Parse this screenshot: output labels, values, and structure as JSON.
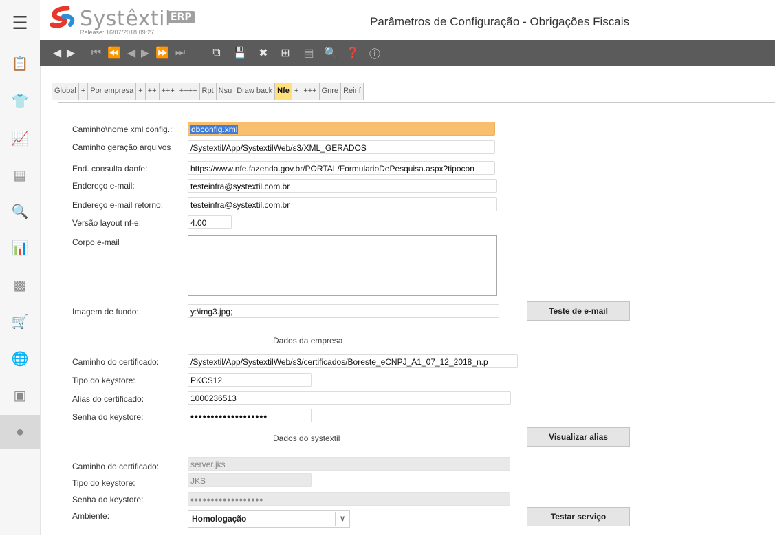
{
  "app": {
    "logo_text": "Systêxtil",
    "erp_badge": "ERP",
    "release": "Release: 16/07/2018 09:27",
    "title": "Parâmetros de Configuração - Obrigações Fiscais"
  },
  "sidebar_icons": [
    "hamburger-icon",
    "clipboard-icon",
    "shirt-icon",
    "chart-icon",
    "calculator-icon",
    "document-search-icon",
    "bar-chart-icon",
    "building-icon",
    "cart-icon",
    "globe-icon",
    "monitor-icon",
    "circle-nav-icon"
  ],
  "toolbar_icons": [
    "play-back",
    "play-forward",
    "first",
    "previous-page",
    "previous",
    "next",
    "next-page",
    "last",
    "new",
    "save",
    "delete",
    "export",
    "records",
    "zoom",
    "help",
    "info"
  ],
  "tabs": [
    {
      "label": "Global"
    },
    {
      "label": "+"
    },
    {
      "label": "Por empresa"
    },
    {
      "label": "+"
    },
    {
      "label": "++"
    },
    {
      "label": "+++"
    },
    {
      "label": "++++"
    },
    {
      "label": "Rpt"
    },
    {
      "label": "Nsu"
    },
    {
      "label": "Draw back"
    },
    {
      "label": "Nfe"
    },
    {
      "label": "+"
    },
    {
      "label": "+++"
    },
    {
      "label": "Gnre"
    },
    {
      "label": "Reinf"
    }
  ],
  "active_tab": "Nfe",
  "form": {
    "xml_config": {
      "label": "Caminho\\nome xml config.:",
      "value": "dbconfig.xml"
    },
    "geracao": {
      "label": "Caminho geração arquivos",
      "value": "/Systextil/App/SystextilWeb/s3/XML_GERADOS"
    },
    "danfe": {
      "label": "End. consulta danfe:",
      "value": "https://www.nfe.fazenda.gov.br/PORTAL/FormularioDePesquisa.aspx?tipocon"
    },
    "email": {
      "label": "Endereço e-mail:",
      "value": "testeinfra@systextil.com.br"
    },
    "email_retorno": {
      "label": "Endereço e-mail retorno:",
      "value": "testeinfra@systextil.com.br"
    },
    "versao": {
      "label": "Versão layout nf-e:",
      "value": "4.00"
    },
    "corpo": {
      "label": "Corpo e-mail",
      "value": ""
    },
    "imagem": {
      "label": "Imagem de fundo:",
      "value": "y:\\img3.jpg;"
    }
  },
  "empresa": {
    "section_title": "Dados da empresa",
    "certificado": {
      "label": "Caminho do certificado:",
      "value": "/Systextil/App/SystextilWeb/s3/certificados/Boreste_eCNPJ_A1_07_12_2018_n.p"
    },
    "tipo": {
      "label": "Tipo do keystore:",
      "value": "PKCS12"
    },
    "alias": {
      "label": "Alias do certificado:",
      "value": "1000236513"
    },
    "senha": {
      "label": "Senha do keystore:",
      "value": "•••••••••••••••••••"
    }
  },
  "systextil": {
    "section_title": "Dados do systextil",
    "certificado": {
      "label": "Caminho do certificado:",
      "value": "server.jks"
    },
    "tipo": {
      "label": "Tipo do keystore:",
      "value": "JKS"
    },
    "senha": {
      "label": "Senha do keystore:",
      "value": "••••••••••••••••••"
    },
    "ambiente": {
      "label": "Ambiente:",
      "value": "Homologação"
    }
  },
  "buttons": {
    "teste_email": "Teste de e-mail",
    "visualizar_alias": "Visualizar alias",
    "testar_servico": "Testar serviço"
  }
}
